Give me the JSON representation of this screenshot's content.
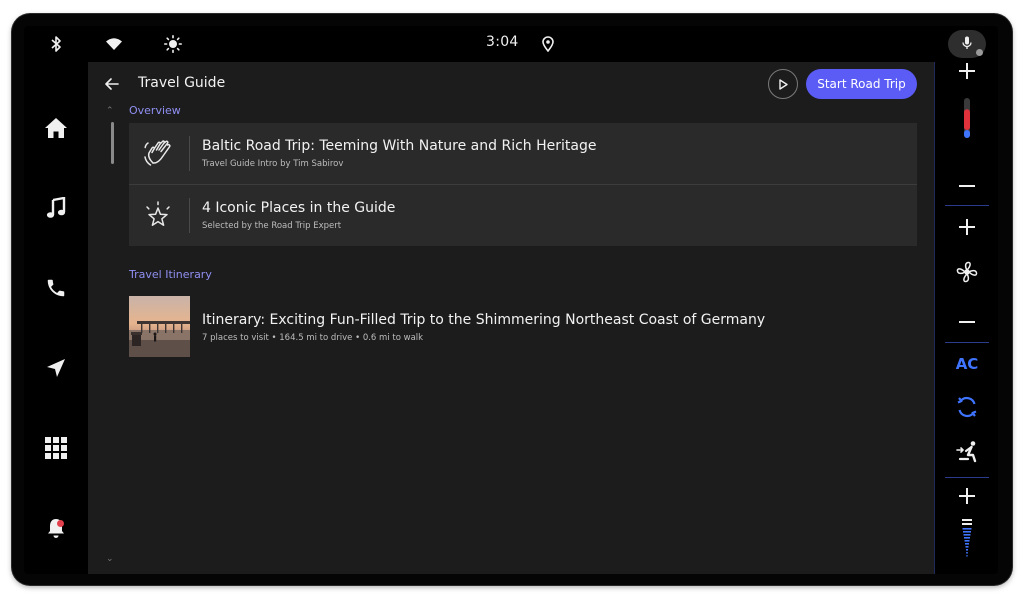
{
  "status_bar": {
    "time": "3:04",
    "icons": [
      "bluetooth-icon",
      "wifi-icon",
      "brightness-icon",
      "location-pin-icon",
      "mic-icon"
    ]
  },
  "left_rail": {
    "items": [
      "home-icon",
      "music-icon",
      "phone-icon",
      "navigation-icon",
      "apps-grid-icon",
      "notification-bell-icon"
    ]
  },
  "header": {
    "title": "Travel Guide",
    "start_button_label": "Start Road Trip"
  },
  "overview": {
    "label": "Overview",
    "cards": [
      {
        "title": "Baltic Road Trip: Teeming With Nature and Rich Heritage",
        "subtitle": "Travel Guide Intro by Tim Sabirov",
        "icon": "waving-hand-icon"
      },
      {
        "title": "4 Iconic Places in the Guide",
        "subtitle": "Selected by the Road Trip Expert",
        "icon": "sparkle-star-icon"
      }
    ]
  },
  "itinerary": {
    "label": "Travel Itinerary",
    "title": "Itinerary: Exciting Fun-Filled Trip to the Shimmering Northeast Coast of Germany",
    "subtitle": "7 places to visit • 164.5 mi to drive • 0.6 mi to walk"
  },
  "climate": {
    "ac_label": "AC",
    "temperature_level": 0.65,
    "fan_speed_level": 0.8,
    "controls": [
      "temp-plus",
      "thermometer",
      "temp-minus",
      "fan-plus",
      "fan",
      "fan-minus",
      "ac",
      "recirculation",
      "seat-airflow",
      "seat-heat-plus",
      "seat-heat-level",
      "seat-heat-minus"
    ]
  },
  "colors": {
    "accent": "#5b5bf5",
    "section_label": "#8f8ff2",
    "climate_blue": "#3f74ff",
    "temp_red": "#e0313d",
    "panel_bg": "#1c1c1c",
    "card_bg": "#2a2a2a"
  }
}
